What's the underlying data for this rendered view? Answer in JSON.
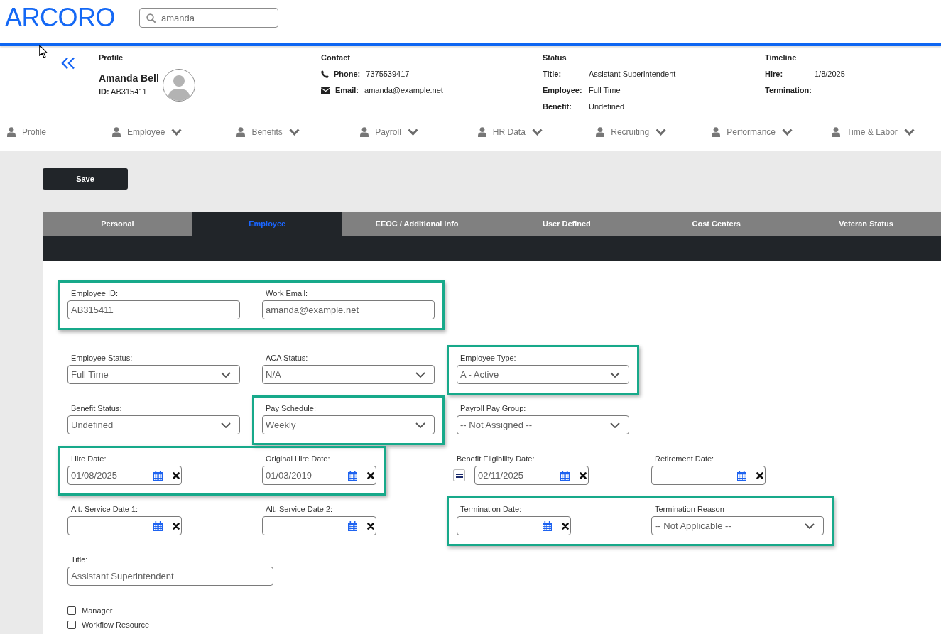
{
  "header": {
    "logo": "ARCORO",
    "search": {
      "value": "amanda"
    }
  },
  "profile": {
    "title": "Profile",
    "name": "Amanda Bell",
    "id_label": "ID:",
    "id_value": "AB315411"
  },
  "contact": {
    "title": "Contact",
    "rows": [
      {
        "kind": "phone",
        "label": "Phone:",
        "value": "7375539417"
      },
      {
        "kind": "email",
        "label": "Email:",
        "value": "amanda@example.net"
      }
    ]
  },
  "status": {
    "title": "Status",
    "rows": [
      {
        "label": "Title:",
        "value": "Assistant Superintendent"
      },
      {
        "label": "Employee:",
        "value": "Full Time"
      },
      {
        "label": "Benefit:",
        "value": "Undefined"
      }
    ]
  },
  "timeline": {
    "title": "Timeline",
    "rows": [
      {
        "label": "Hire:",
        "value": "1/8/2025"
      },
      {
        "label": "Termination:"
      }
    ]
  },
  "nav": [
    {
      "label": "Profile",
      "dropdown": false
    },
    {
      "label": "Employee",
      "dropdown": true
    },
    {
      "label": "Benefits",
      "dropdown": true
    },
    {
      "label": "Payroll",
      "dropdown": true
    },
    {
      "label": "HR Data",
      "dropdown": true
    },
    {
      "label": "Recruiting",
      "dropdown": true
    },
    {
      "label": "Performance",
      "dropdown": true
    },
    {
      "label": "Time & Labor",
      "dropdown": true
    }
  ],
  "save_button": {
    "label": "Save"
  },
  "tabs": [
    {
      "label": "Personal",
      "selected": false
    },
    {
      "label": "Employee",
      "selected": true
    },
    {
      "label": "EEOC / Additional Info",
      "selected": false
    },
    {
      "label": "User Defined",
      "selected": false
    },
    {
      "label": "Cost Centers",
      "selected": false
    },
    {
      "label": "Veteran Status",
      "selected": false
    }
  ],
  "form": {
    "rows": [
      {
        "groups": [
          {
            "highlighted": true,
            "fields": [
              {
                "kind": "text",
                "label": "Employee ID:",
                "value": "AB315411"
              },
              {
                "kind": "text",
                "label": "Work Email:",
                "value": "amanda@example.net"
              }
            ]
          }
        ]
      },
      {
        "groups": [
          {
            "highlighted": false,
            "fields": [
              {
                "kind": "select",
                "label": "Employee Status:",
                "value": "Full Time"
              }
            ]
          },
          {
            "highlighted": false,
            "fields": [
              {
                "kind": "select",
                "label": "ACA Status:",
                "value": "N/A"
              }
            ]
          },
          {
            "highlighted": true,
            "fields": [
              {
                "kind": "select",
                "label": "Employee Type:",
                "value": "A - Active"
              }
            ]
          }
        ]
      },
      {
        "groups": [
          {
            "highlighted": false,
            "fields": [
              {
                "kind": "select",
                "label": "Benefit Status:",
                "value": "Undefined"
              }
            ]
          },
          {
            "highlighted": true,
            "fields": [
              {
                "kind": "select",
                "label": "Pay Schedule:",
                "value": "Weekly"
              }
            ]
          },
          {
            "highlighted": false,
            "fields": [
              {
                "kind": "select",
                "label": "Payroll Pay Group:",
                "value": "-- Not Assigned --"
              }
            ]
          }
        ]
      },
      {
        "groups": [
          {
            "highlighted": true,
            "fields": [
              {
                "kind": "date",
                "label": "Hire Date:",
                "value": "01/08/2025"
              },
              {
                "kind": "date",
                "label": "Original Hire Date:",
                "value": "01/03/2019"
              }
            ]
          },
          {
            "highlighted": false,
            "fields": [
              {
                "kind": "date",
                "label": "Benefit Eligibility Date:",
                "value": "02/11/2025",
                "equals_button": true
              }
            ]
          },
          {
            "highlighted": false,
            "fields": [
              {
                "kind": "date",
                "label": "Retirement Date:"
              }
            ]
          }
        ]
      },
      {
        "groups": [
          {
            "highlighted": false,
            "fields": [
              {
                "kind": "date",
                "label": "Alt. Service Date 1:"
              }
            ]
          },
          {
            "highlighted": false,
            "fields": [
              {
                "kind": "date",
                "label": "Alt. Service Date 2:"
              }
            ]
          },
          {
            "highlighted": true,
            "fields": [
              {
                "kind": "date",
                "label": "Termination Date:"
              },
              {
                "kind": "select",
                "label": "Termination Reason",
                "value": "-- Not Applicable --"
              }
            ]
          }
        ]
      },
      {
        "groups": [
          {
            "highlighted": false,
            "fields": [
              {
                "kind": "text",
                "label": "Title:",
                "value": "Assistant Superintendent"
              }
            ]
          }
        ]
      }
    ],
    "checkboxes": [
      {
        "label": "Manager",
        "checked": false
      },
      {
        "label": "Workflow Resource",
        "checked": false
      }
    ]
  }
}
